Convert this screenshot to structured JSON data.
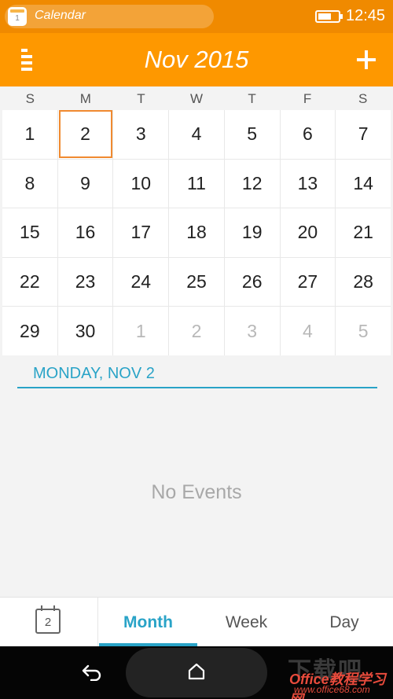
{
  "status_bar": {
    "notification_title": "Calendar",
    "app_icon_text": "1",
    "time": "12:45"
  },
  "app_bar": {
    "title": "Nov 2015",
    "menu_icon": "menu-icon",
    "add_icon": "add-icon"
  },
  "calendar": {
    "weekdays": [
      "S",
      "M",
      "T",
      "W",
      "T",
      "F",
      "S"
    ],
    "days": [
      {
        "label": "1",
        "other": false
      },
      {
        "label": "2",
        "other": false
      },
      {
        "label": "3",
        "other": false
      },
      {
        "label": "4",
        "other": false
      },
      {
        "label": "5",
        "other": false
      },
      {
        "label": "6",
        "other": false
      },
      {
        "label": "7",
        "other": false
      },
      {
        "label": "8",
        "other": false
      },
      {
        "label": "9",
        "other": false
      },
      {
        "label": "10",
        "other": false
      },
      {
        "label": "11",
        "other": false
      },
      {
        "label": "12",
        "other": false
      },
      {
        "label": "13",
        "other": false
      },
      {
        "label": "14",
        "other": false
      },
      {
        "label": "15",
        "other": false
      },
      {
        "label": "16",
        "other": false
      },
      {
        "label": "17",
        "other": false
      },
      {
        "label": "18",
        "other": false
      },
      {
        "label": "19",
        "other": false
      },
      {
        "label": "20",
        "other": false
      },
      {
        "label": "21",
        "other": false
      },
      {
        "label": "22",
        "other": false
      },
      {
        "label": "23",
        "other": false
      },
      {
        "label": "24",
        "other": false
      },
      {
        "label": "25",
        "other": false
      },
      {
        "label": "26",
        "other": false
      },
      {
        "label": "27",
        "other": false
      },
      {
        "label": "28",
        "other": false
      },
      {
        "label": "29",
        "other": false
      },
      {
        "label": "30",
        "other": false
      },
      {
        "label": "1",
        "other": true
      },
      {
        "label": "2",
        "other": true
      },
      {
        "label": "3",
        "other": true
      },
      {
        "label": "4",
        "other": true
      },
      {
        "label": "5",
        "other": true
      }
    ],
    "selected_index": 1,
    "selected_color": "#f08a30"
  },
  "day_panel": {
    "header": "MONDAY, NOV 2",
    "empty_text": "No Events"
  },
  "tabs": {
    "today_icon_text": "2",
    "month": "Month",
    "week": "Week",
    "day": "Day",
    "active": "month",
    "accent_color": "#29a3c7"
  },
  "watermark": {
    "line1": "下载吧",
    "line2": "Office教程学习网",
    "line3": "www.office68.com"
  },
  "colors": {
    "status_bar": "#f08a00",
    "app_bar": "#fe9800"
  }
}
